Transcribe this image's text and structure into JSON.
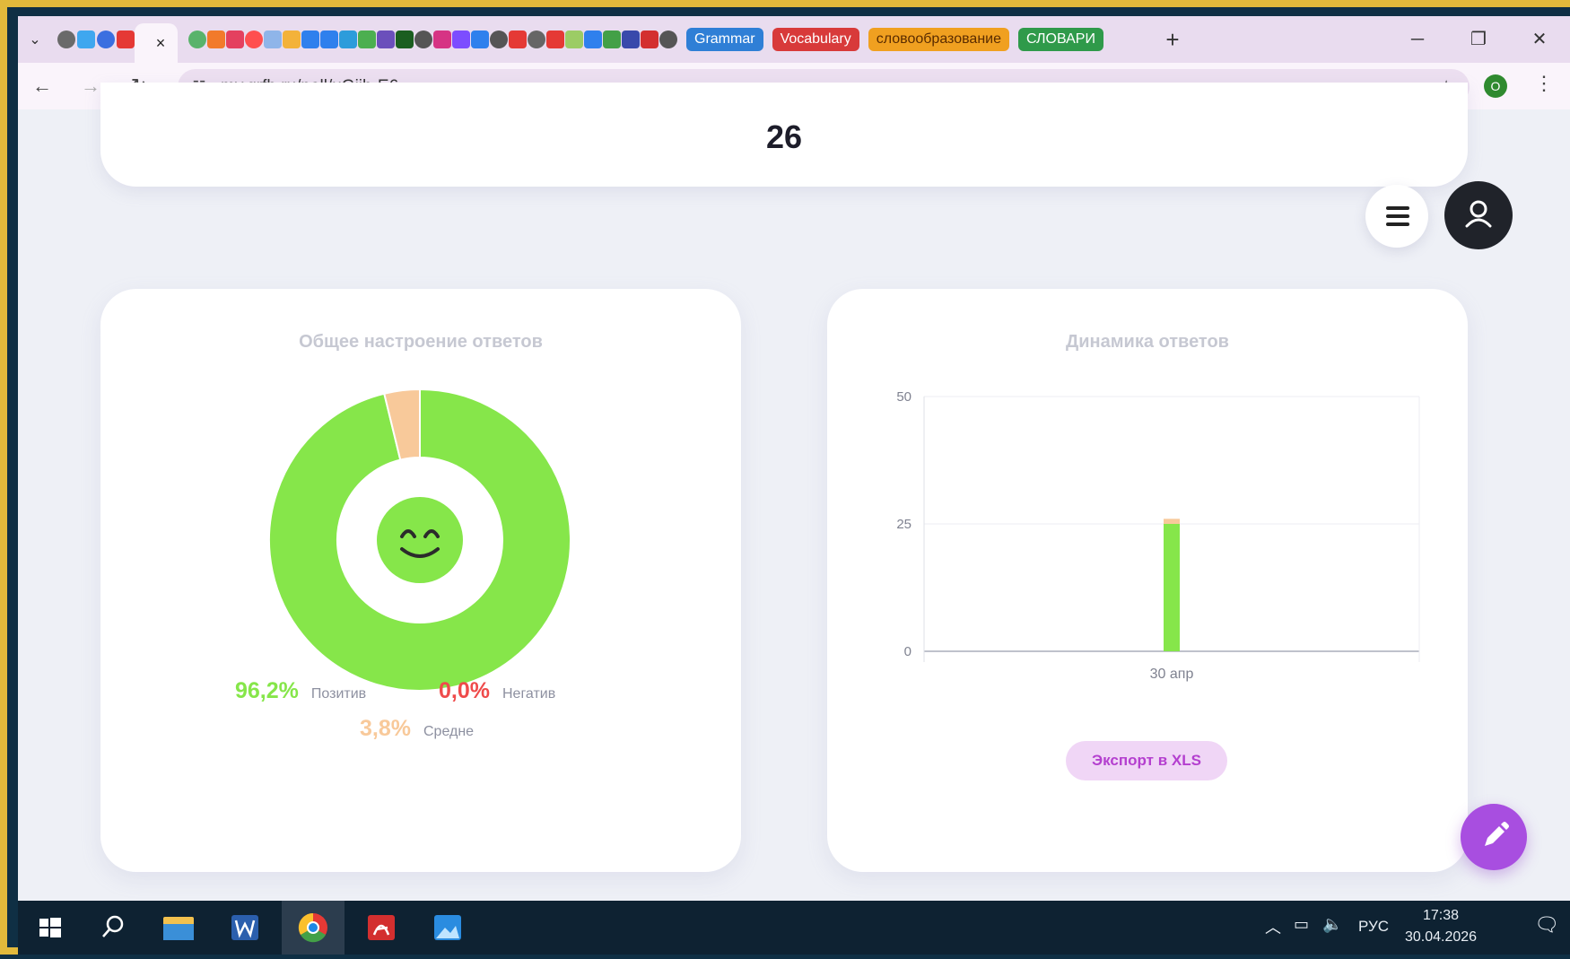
{
  "browser": {
    "tab_close_glyph": "×",
    "bookmark_chips": [
      {
        "label": "Grammar",
        "color": "#2f7fd6"
      },
      {
        "label": "Vocabulary",
        "color": "#d83a3a"
      },
      {
        "label": "словообразование",
        "color": "#f0a020"
      },
      {
        "label": "СЛОВАРИ",
        "color": "#2f9a4a"
      }
    ],
    "url": "my.qrfb.ru/poll/uGjih-E6",
    "profile_initial": "O"
  },
  "summary": {
    "total_answers": "26"
  },
  "mood_card": {
    "title": "Общее настроение ответов",
    "legend": [
      {
        "value": "96,2%",
        "label": "Позитив",
        "color": "#86e64a"
      },
      {
        "value": "0,0%",
        "label": "Негатив",
        "color": "#ef4b4b"
      },
      {
        "value": "3,8%",
        "label": "Средне",
        "color": "#f8c99a"
      }
    ]
  },
  "dynamics_card": {
    "title": "Динамика ответов",
    "export_label": "Экспорт в XLS"
  },
  "chart_data": [
    {
      "type": "pie",
      "donut": true,
      "title": "Общее настроение ответов",
      "series": [
        {
          "name": "Позитив",
          "value": 96.2,
          "color": "#86e64a"
        },
        {
          "name": "Негатив",
          "value": 0.0,
          "color": "#ef4b4b"
        },
        {
          "name": "Средне",
          "value": 3.8,
          "color": "#f8c99a"
        }
      ]
    },
    {
      "type": "bar",
      "stacked": true,
      "title": "Динамика ответов",
      "categories": [
        "30 апр"
      ],
      "series": [
        {
          "values": [
            25
          ],
          "color": "#86e64a"
        },
        {
          "values": [
            1
          ],
          "color": "#f8c99a"
        }
      ],
      "yticks": [
        "0",
        "25",
        "50"
      ],
      "ylim": [
        0,
        50
      ],
      "grid": true
    }
  ],
  "taskbar": {
    "lang": "РУС",
    "time": "17:38",
    "date": "30.04.2026"
  }
}
